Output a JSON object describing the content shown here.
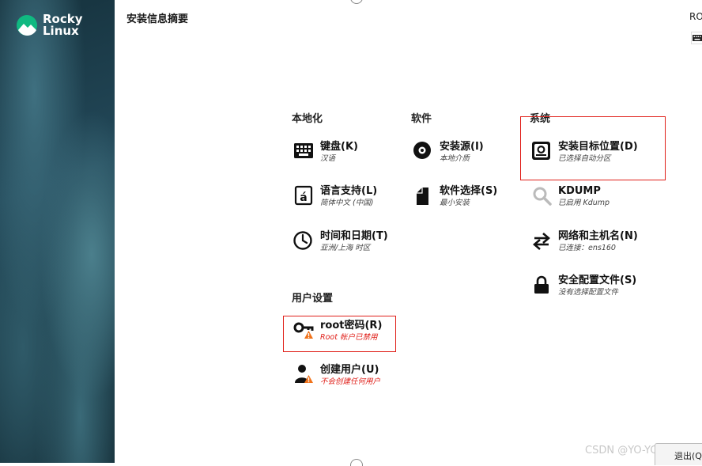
{
  "app": {
    "logo_line1": "Rocky",
    "logo_line2": "Linux",
    "page_title": "安装信息摘要",
    "top_right": "RO",
    "quit_label": "退出(Q",
    "watermark": "CSDN @YO-YO.YXX"
  },
  "sections": {
    "localization": "本地化",
    "software": "软件",
    "system": "系统",
    "user_settings": "用户设置"
  },
  "spokes": {
    "keyboard": {
      "title": "键盘(K)",
      "status": "汉语",
      "icon": "keyboard-icon"
    },
    "language": {
      "title": "语言支持(L)",
      "status": "简体中文 (中国)",
      "icon": "language-icon"
    },
    "datetime": {
      "title": "时间和日期(T)",
      "status": "亚洲/上海 时区",
      "icon": "clock-icon"
    },
    "source": {
      "title": "安装源(I)",
      "status": "本地介质",
      "icon": "disc-icon"
    },
    "software": {
      "title": "软件选择(S)",
      "status": "最小安装",
      "icon": "package-icon"
    },
    "destination": {
      "title": "安装目标位置(D)",
      "status": "已选择自动分区",
      "icon": "harddisk-icon"
    },
    "kdump": {
      "title": "KDUMP",
      "status": "已启用 Kdump",
      "icon": "magnifier-icon"
    },
    "network": {
      "title": "网络和主机名(N)",
      "status": "已连接：ens160",
      "icon": "network-arrows-icon"
    },
    "security": {
      "title": "安全配置文件(S)",
      "status": "没有选择配置文件",
      "icon": "lock-icon"
    },
    "root": {
      "title": "root密码(R)",
      "status": "Root 帐户已禁用",
      "icon": "key-warning-icon"
    },
    "user": {
      "title": "创建用户(U)",
      "status": "不会创建任何用户",
      "icon": "user-warning-icon"
    }
  },
  "colors": {
    "warning": "#e0201a",
    "highlight": "#e0201a",
    "logo_green": "#10b981"
  }
}
